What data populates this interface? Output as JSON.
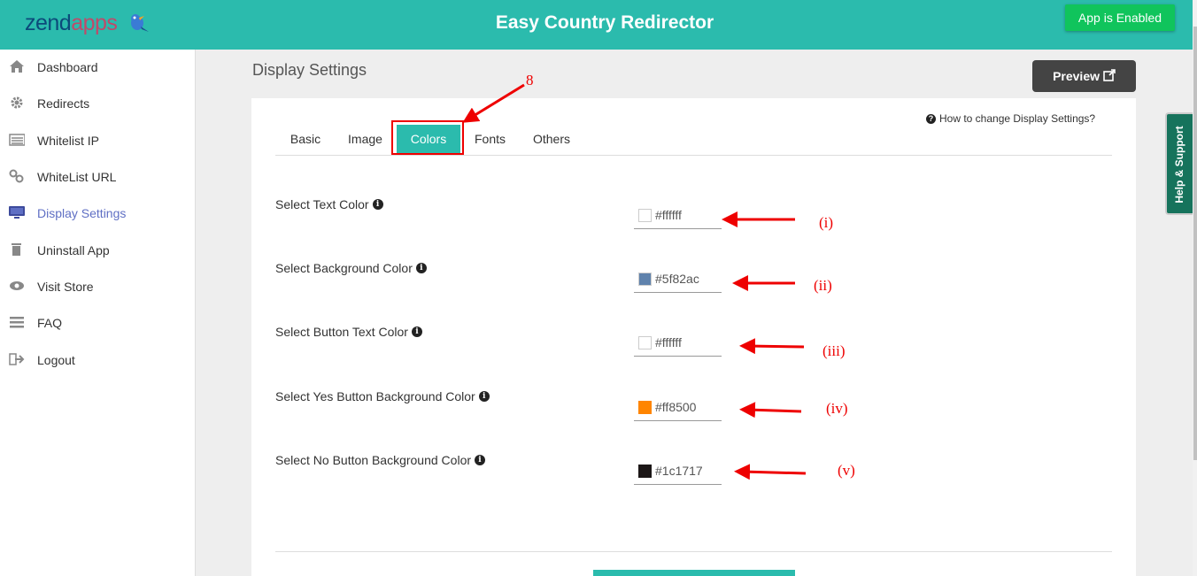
{
  "header": {
    "logo_part1": "zend",
    "logo_part2": "apps",
    "title": "Easy Country Redirector",
    "status_button": "App is Enabled"
  },
  "sidebar": {
    "items": [
      {
        "label": "Dashboard",
        "icon": "home-icon"
      },
      {
        "label": "Redirects",
        "icon": "gear-icon"
      },
      {
        "label": "Whitelist IP",
        "icon": "list-icon"
      },
      {
        "label": "WhiteList URL",
        "icon": "link-icon"
      },
      {
        "label": "Display Settings",
        "icon": "monitor-icon",
        "active": true
      },
      {
        "label": "Uninstall App",
        "icon": "trash-icon"
      },
      {
        "label": "Visit Store",
        "icon": "eye-icon"
      },
      {
        "label": "FAQ",
        "icon": "menu-icon"
      },
      {
        "label": "Logout",
        "icon": "logout-icon"
      }
    ]
  },
  "main": {
    "page_title": "Display Settings",
    "preview_button": "Preview",
    "help_link": "How to change Display Settings?",
    "tabs": [
      {
        "label": "Basic"
      },
      {
        "label": "Image"
      },
      {
        "label": "Colors",
        "active": true
      },
      {
        "label": "Fonts"
      },
      {
        "label": "Others"
      }
    ],
    "fields": [
      {
        "label": "Select Text Color",
        "value": "#ffffff",
        "swatch": "#ffffff"
      },
      {
        "label": "Select Background Color",
        "value": "#5f82ac",
        "swatch": "#5f82ac"
      },
      {
        "label": "Select Button Text Color",
        "value": "#ffffff",
        "swatch": "#ffffff"
      },
      {
        "label": "Select Yes Button Background Color",
        "value": "#ff8500",
        "swatch": "#ff8500"
      },
      {
        "label": "Select No Button Background Color",
        "value": "#1c1717",
        "swatch": "#1c1717"
      }
    ]
  },
  "annotations": {
    "step": "8",
    "markers": [
      "(i)",
      "(ii)",
      "(iii)",
      "(iv)",
      "(v)"
    ]
  },
  "help_tab": "Help & Support",
  "colors": {
    "accent": "#2bbbad",
    "enabled": "#10c45c",
    "annotation": "#ee0000"
  }
}
